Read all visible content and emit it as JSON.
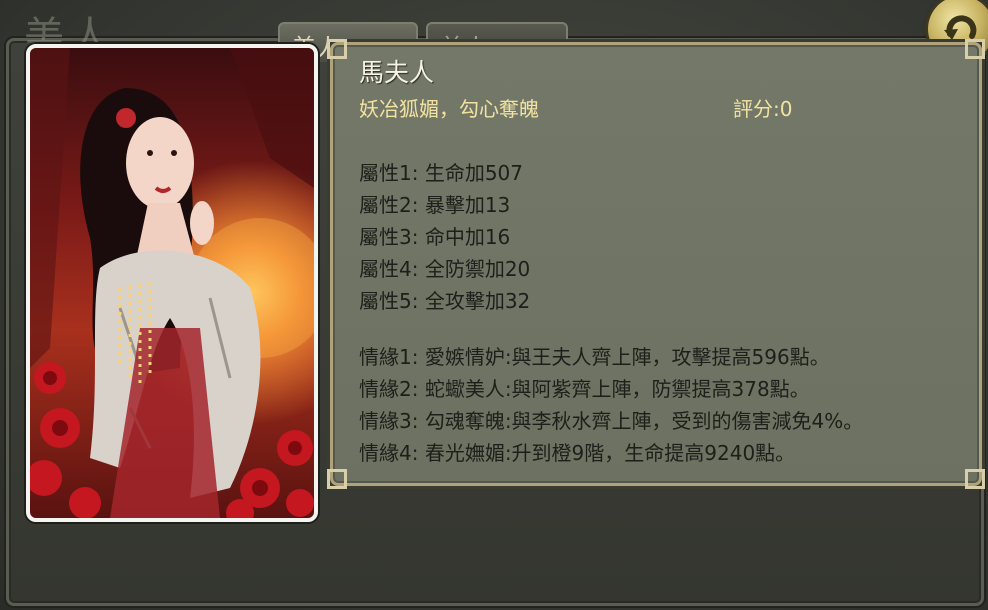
{
  "window": {
    "bg_title": "美人",
    "tabs": [
      "美人",
      "美人"
    ]
  },
  "refresh_button": {
    "icon": "refresh-arrow-icon"
  },
  "portrait": {
    "subject": "beauty-character-illustration"
  },
  "character": {
    "name": "馬夫人",
    "tagline": "妖冶狐媚，勾心奪魄",
    "score": "評分:0",
    "attributes": [
      "屬性1: 生命加507",
      "屬性2: 暴擊加13",
      "屬性3: 命中加16",
      "屬性4: 全防禦加20",
      "屬性5: 全攻擊加32"
    ],
    "bonds": [
      "情緣1: 愛嫉情妒:與王夫人齊上陣，攻擊提高596點。",
      "情緣2: 蛇蠍美人:與阿紫齊上陣，防禦提高378點。",
      "情緣3: 勾魂奪魄:與李秋水齊上陣，受到的傷害減免4%。",
      "情緣4: 春光嫵媚:升到橙9階，生命提高9240點。"
    ]
  },
  "colors": {
    "panel_bg": "#717565",
    "panel_border": "#b0a27a",
    "tagline": "#f2e3a0",
    "name": "#f6f3e4",
    "body_text": "#1e1f1a"
  }
}
